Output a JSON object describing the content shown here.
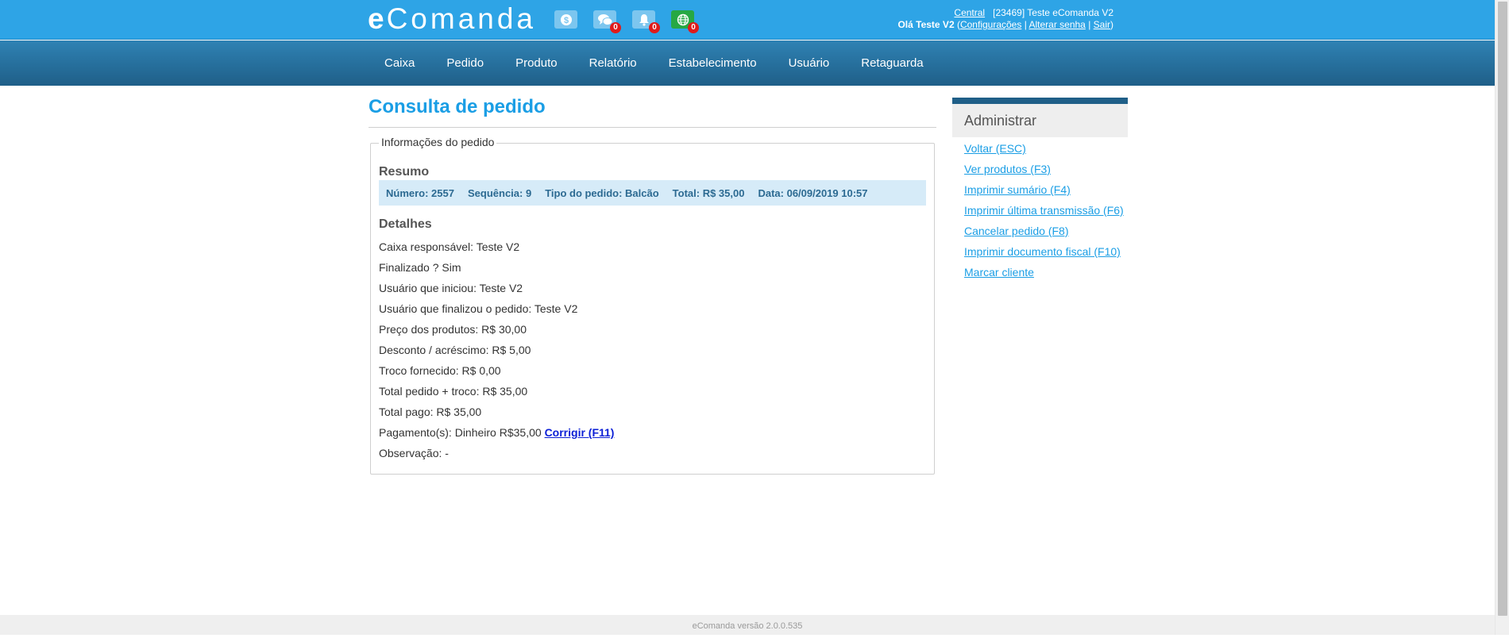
{
  "header": {
    "logo_e": "e",
    "logo_rest": "Comanda",
    "icons": [
      {
        "name": "money-icon",
        "badge": null
      },
      {
        "name": "chat-icon",
        "badge": "0"
      },
      {
        "name": "bell-icon",
        "badge": "0"
      },
      {
        "name": "globe-icon",
        "badge": "0"
      }
    ],
    "central_link": "Central",
    "store_info": "[23469] Teste eComanda V2",
    "greeting": "Olá Teste V2",
    "config_link": "Configurações",
    "change_password_link": "Alterar senha",
    "logout_link": "Sair",
    "sep1": " (",
    "sep2": " | ",
    "sep3": " | ",
    "sep4": ")"
  },
  "nav": {
    "items": [
      "Caixa",
      "Pedido",
      "Produto",
      "Relatório",
      "Estabelecimento",
      "Usuário",
      "Retaguarda"
    ]
  },
  "main": {
    "title": "Consulta de pedido",
    "legend": "Informações do pedido",
    "summary_heading": "Resumo",
    "summary": {
      "numero": "Número: 2557",
      "sequencia": "Sequência: 9",
      "tipo": "Tipo do pedido: Balcão",
      "total": "Total: R$ 35,00",
      "data": "Data: 06/09/2019 10:57"
    },
    "details_heading": "Detalhes",
    "details": [
      "Caixa responsável: Teste V2",
      "Finalizado ? Sim",
      "Usuário que iniciou: Teste V2",
      "Usuário que finalizou o pedido: Teste V2",
      "Preço dos produtos: R$ 30,00",
      "Desconto / acréscimo: R$ 5,00",
      "Troco fornecido: R$ 0,00",
      "Total pedido + troco: R$ 35,00",
      "Total pago: R$ 35,00"
    ],
    "payment_text": "Pagamento(s): Dinheiro R$35,00",
    "payment_fix_link": "Corrigir (F11)",
    "observation": "Observação: -"
  },
  "sidebar": {
    "heading": "Administrar",
    "links": [
      "Voltar (ESC)",
      "Ver produtos (F3)",
      "Imprimir sumário (F4)",
      "Imprimir última transmissão (F6)",
      "Cancelar pedido (F8)",
      "Imprimir documento fiscal (F10)",
      "Marcar cliente"
    ]
  },
  "footer": {
    "version": "eComanda versão 2.0.0.535"
  },
  "colors": {
    "topbar": "#2ea4e6",
    "nav": "#1f5f88",
    "title": "#1a9ee5",
    "summary_bg": "#d6ebf8",
    "badge": "#e01b1b",
    "green_icon": "#27a844"
  }
}
